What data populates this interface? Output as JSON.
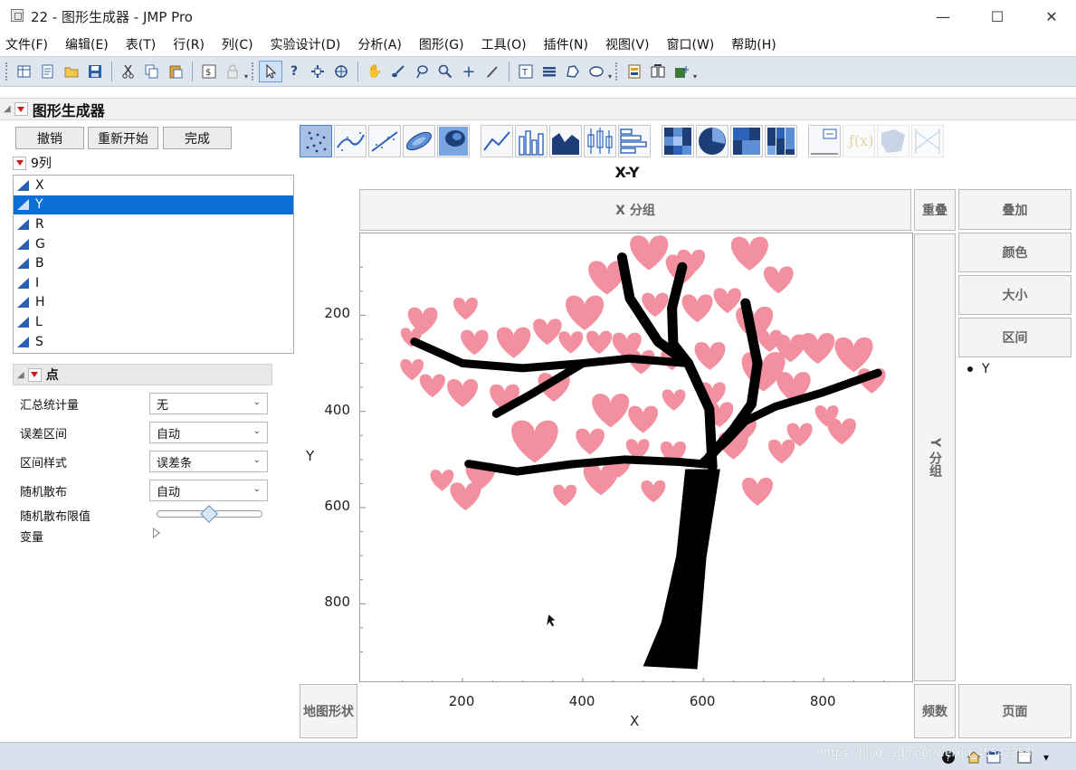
{
  "window": {
    "title": "22 - 图形生成器 - JMP Pro",
    "minimize": "—",
    "maximize": "☐",
    "close": "✕"
  },
  "menu": [
    "文件(F)",
    "编辑(E)",
    "表(T)",
    "行(R)",
    "列(C)",
    "实验设计(D)",
    "分析(A)",
    "图形(G)",
    "工具(O)",
    "插件(N)",
    "视图(V)",
    "窗口(W)",
    "帮助(H)"
  ],
  "toolbar": {
    "file_icons": [
      "new-table-icon",
      "new-script-icon",
      "open-icon",
      "save-icon"
    ],
    "edit_icons": [
      "cut-icon",
      "copy-icon",
      "paste-icon",
      "script-icon",
      "lock-icon"
    ],
    "tool_icons": [
      "arrow-icon",
      "help-icon",
      "selection-icon",
      "crosshair-icon",
      "hand-icon",
      "brush-icon",
      "lasso-icon",
      "magnifier-icon",
      "plus-icon",
      "annotate-icon"
    ],
    "draw_icons": [
      "text-icon",
      "line-icon",
      "polygon-icon",
      "ellipse-icon"
    ],
    "misc_icons": [
      "report-icon",
      "compare-icon",
      "addins-icon"
    ]
  },
  "report": {
    "title": "图形生成器"
  },
  "buttons": {
    "undo": "撤销",
    "restart": "重新开始",
    "done": "完成"
  },
  "columns": {
    "header": "9列",
    "items": [
      "X",
      "Y",
      "R",
      "G",
      "B",
      "I",
      "H",
      "L",
      "S"
    ],
    "selected": "Y"
  },
  "points_panel": {
    "title": "点",
    "options": [
      {
        "label": "汇总统计量",
        "value": "无"
      },
      {
        "label": "误差区间",
        "value": "自动"
      },
      {
        "label": "区间样式",
        "value": "误差条"
      },
      {
        "label": "随机散布",
        "value": "自动"
      }
    ],
    "jitter_limit_label": "随机散布限值",
    "jitter_limit": 0.5,
    "variables_label": "变量"
  },
  "chart": {
    "title": "X-Y",
    "x_group": "X 分组",
    "y_group": "Y 分组",
    "overlay_zone": "重叠",
    "right_zones": [
      "叠加",
      "颜色",
      "大小",
      "区间"
    ],
    "map_shape": "地图形状",
    "freq": "频数",
    "page": "页面",
    "legend": "Y",
    "colors": {
      "petal": "#f2909f",
      "trunk": "#000000"
    }
  },
  "chart_data": {
    "type": "scatter",
    "title": "X-Y",
    "xlabel": "X",
    "ylabel": "Y",
    "xlim": [
      30,
      950
    ],
    "ylim": [
      965,
      30
    ],
    "x_ticks": [
      200,
      400,
      600,
      800
    ],
    "y_ticks": [
      200,
      400,
      600,
      800
    ],
    "y_reversed": true,
    "series": [
      {
        "name": "Y",
        "color": "#f2909f",
        "hearts": [
          [
            510,
            68,
            72
          ],
          [
            565,
            103,
            62
          ],
          [
            580,
            88,
            52
          ],
          [
            677,
            70,
            70
          ],
          [
            725,
            125,
            56
          ],
          [
            440,
            120,
            70
          ],
          [
            640,
            168,
            52
          ],
          [
            590,
            184,
            58
          ],
          [
            520,
            177,
            50
          ],
          [
            403,
            193,
            72
          ],
          [
            341,
            233,
            54
          ],
          [
            380,
            255,
            46
          ],
          [
            285,
            255,
            64
          ],
          [
            220,
            255,
            52
          ],
          [
            134,
            210,
            56
          ],
          [
            205,
            185,
            46
          ],
          [
            115,
            245,
            40
          ],
          [
            473,
            262,
            55
          ],
          [
            427,
            255,
            48
          ],
          [
            497,
            296,
            50
          ],
          [
            548,
            292,
            42
          ],
          [
            611,
            283,
            58
          ],
          [
            685,
            215,
            70
          ],
          [
            710,
            252,
            46
          ],
          [
            745,
            267,
            58
          ],
          [
            790,
            267,
            64
          ],
          [
            850,
            280,
            72
          ],
          [
            880,
            335,
            52
          ],
          [
            700,
            315,
            82
          ],
          [
            750,
            348,
            64
          ],
          [
            615,
            363,
            50
          ],
          [
            627,
            405,
            52
          ],
          [
            668,
            437,
            46
          ],
          [
            650,
            470,
            56
          ],
          [
            551,
            375,
            44
          ],
          [
            446,
            396,
            70
          ],
          [
            500,
            415,
            56
          ],
          [
            352,
            348,
            60
          ],
          [
            270,
            370,
            56
          ],
          [
            200,
            360,
            58
          ],
          [
            150,
            345,
            48
          ],
          [
            116,
            312,
            44
          ],
          [
            320,
            460,
            88
          ],
          [
            412,
            461,
            54
          ],
          [
            491,
            478,
            44
          ],
          [
            460,
            514,
            44
          ],
          [
            550,
            485,
            48
          ],
          [
            230,
            533,
            56
          ],
          [
            166,
            542,
            44
          ],
          [
            205,
            575,
            58
          ],
          [
            370,
            573,
            44
          ],
          [
            430,
            539,
            66
          ],
          [
            517,
            565,
            46
          ],
          [
            690,
            565,
            58
          ],
          [
            730,
            482,
            50
          ],
          [
            760,
            447,
            48
          ],
          [
            805,
            408,
            44
          ],
          [
            830,
            440,
            54
          ]
        ]
      },
      {
        "name": "branches",
        "color": "#000000",
        "paths": [
          [
            [
              465,
              80
            ],
            [
              478,
              165
            ],
            [
              525,
              255
            ],
            [
              575,
              300
            ],
            [
              610,
              395
            ],
            [
              615,
              515
            ]
          ],
          [
            [
              565,
              100
            ],
            [
              548,
              185
            ],
            [
              550,
              260
            ],
            [
              575,
              300
            ]
          ],
          [
            [
              670,
              175
            ],
            [
              690,
              300
            ],
            [
              680,
              385
            ],
            [
              650,
              438
            ],
            [
              610,
              495
            ]
          ],
          [
            [
              120,
              255
            ],
            [
              200,
              300
            ],
            [
              300,
              310
            ],
            [
              400,
              300
            ],
            [
              478,
              290
            ],
            [
              575,
              300
            ]
          ],
          [
            [
              256,
              405
            ],
            [
              320,
              360
            ],
            [
              400,
              300
            ]
          ],
          [
            [
              890,
              320
            ],
            [
              800,
              360
            ],
            [
              720,
              390
            ],
            [
              670,
              420
            ],
            [
              640,
              460
            ],
            [
              600,
              505
            ]
          ],
          [
            [
              210,
              509
            ],
            [
              290,
              525
            ],
            [
              380,
              510
            ],
            [
              470,
              500
            ],
            [
              560,
              505
            ],
            [
              605,
              510
            ]
          ]
        ]
      },
      {
        "name": "trunk",
        "color": "#000000",
        "polygon": [
          [
            570,
            520
          ],
          [
            628,
            520
          ],
          [
            605,
            705
          ],
          [
            590,
            936
          ],
          [
            500,
            930
          ],
          [
            530,
            840
          ],
          [
            555,
            700
          ]
        ]
      }
    ]
  },
  "status": {
    "watermark": "https://blog.csdn.net/weixin_45542355"
  }
}
